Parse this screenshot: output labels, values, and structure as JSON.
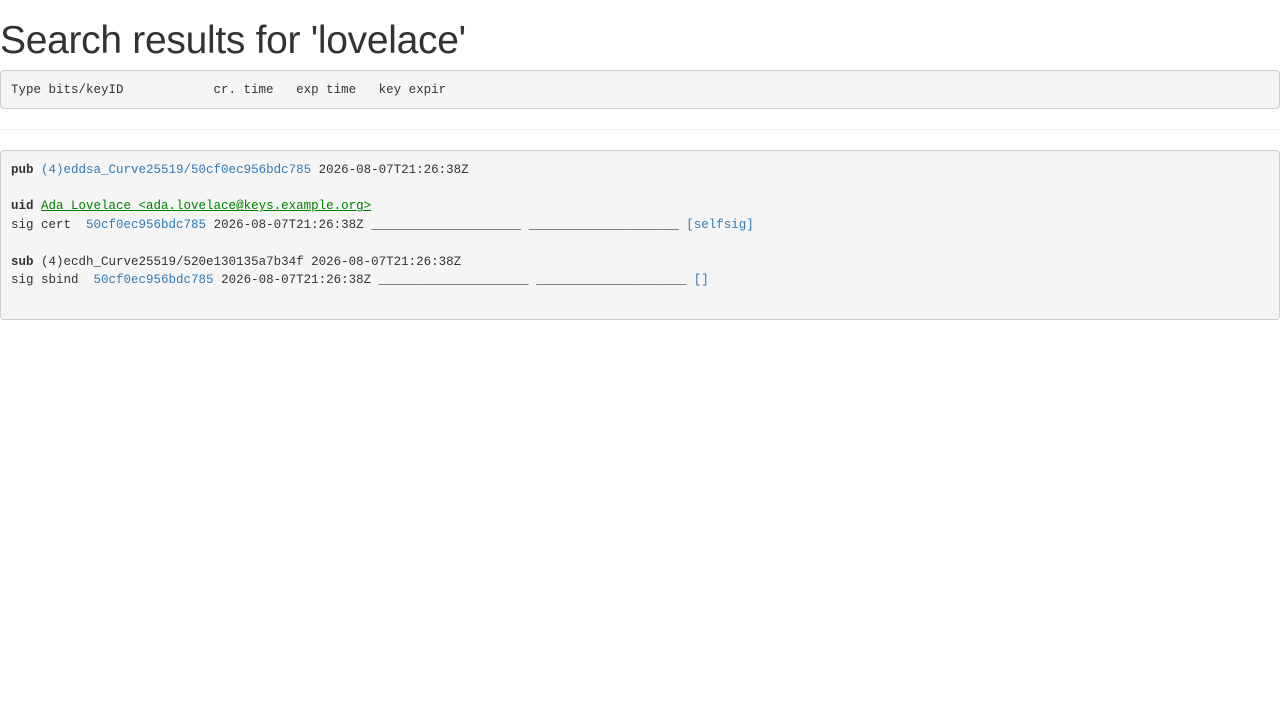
{
  "page": {
    "title": "Search results for 'lovelace'"
  },
  "header_row": {
    "type_bits_keyid": "Type bits/keyID",
    "cr_time": "cr. time",
    "exp_time": "exp time",
    "key_expir": "key expir"
  },
  "result": {
    "pub": {
      "tag": "pub",
      "key_link": "(4)eddsa_Curve25519/50cf0ec956bdc785",
      "created": "2026-08-07T21:26:38Z"
    },
    "uid": {
      "tag": "uid",
      "identity": "Ada Lovelace <ada.lovelace@keys.example.org>"
    },
    "uid_sig": {
      "kind": "sig cert",
      "keyid": "50cf0ec956bdc785",
      "created": "2026-08-07T21:26:38Z",
      "exp_time": "____________________",
      "key_expir": "____________________",
      "signer": "[selfsig]"
    },
    "sub": {
      "tag": "sub",
      "key_text": "(4)ecdh_Curve25519/520e130135a7b34f",
      "created": "2026-08-07T21:26:38Z"
    },
    "sub_sig": {
      "kind": "sig sbind",
      "keyid": "50cf0ec956bdc785",
      "created": "2026-08-07T21:26:38Z",
      "exp_time": "____________________",
      "key_expir": "____________________",
      "signer": "[]"
    }
  },
  "colors": {
    "link": "#337ab7",
    "uid_link": "#008000",
    "text": "#333333",
    "box_bg": "#f5f5f5",
    "box_border": "#cccccc"
  }
}
